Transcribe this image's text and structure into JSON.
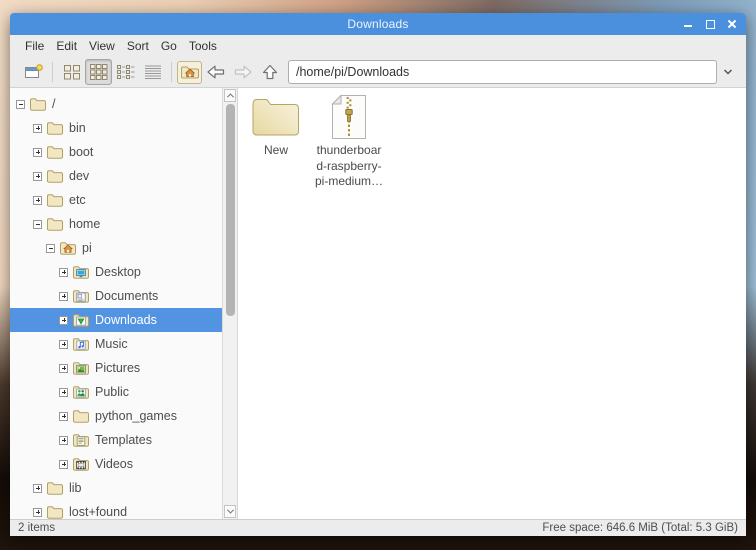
{
  "window": {
    "title": "Downloads",
    "controls": [
      {
        "id": "minimize",
        "icon": "minimize-icon"
      },
      {
        "id": "maximize",
        "icon": "maximize-icon"
      },
      {
        "id": "close",
        "icon": "close-icon"
      }
    ]
  },
  "menubar": {
    "items": [
      "File",
      "Edit",
      "View",
      "Sort",
      "Go",
      "Tools"
    ]
  },
  "toolbar": {
    "path": "/home/pi/Downloads",
    "buttons": [
      {
        "id": "new-window",
        "icon": "new-window-icon"
      },
      {
        "sep": true
      },
      {
        "id": "view-icons",
        "icon": "icon-view-icon"
      },
      {
        "id": "view-thumbnails",
        "icon": "thumbnail-view-icon",
        "active": true
      },
      {
        "id": "view-compact",
        "icon": "compact-view-icon"
      },
      {
        "id": "view-detailed",
        "icon": "detailed-view-icon"
      },
      {
        "sep": true
      },
      {
        "id": "go-home",
        "icon": "home-folder-icon",
        "framed": true
      },
      {
        "id": "go-back",
        "icon": "back-arrow-icon"
      },
      {
        "id": "go-forward",
        "icon": "forward-arrow-icon",
        "disabled": true
      },
      {
        "id": "go-up",
        "icon": "up-arrow-icon"
      },
      {
        "id": "path-dropdown",
        "icon": "chevron-down-icon"
      }
    ]
  },
  "sidebar": {
    "items": [
      {
        "label": "/",
        "level": 0,
        "expander": "minus",
        "icon": "folder"
      },
      {
        "label": "bin",
        "level": 1,
        "expander": "plus",
        "icon": "folder"
      },
      {
        "label": "boot",
        "level": 1,
        "expander": "plus",
        "icon": "folder"
      },
      {
        "label": "dev",
        "level": 1,
        "expander": "plus",
        "icon": "folder"
      },
      {
        "label": "etc",
        "level": 1,
        "expander": "plus",
        "icon": "folder"
      },
      {
        "label": "home",
        "level": 1,
        "expander": "minus",
        "icon": "folder"
      },
      {
        "label": "pi",
        "level": 2,
        "expander": "minus",
        "icon": "folder-home"
      },
      {
        "label": "Desktop",
        "level": 3,
        "expander": "plus",
        "icon": "folder-desktop"
      },
      {
        "label": "Documents",
        "level": 3,
        "expander": "plus",
        "icon": "folder-documents"
      },
      {
        "label": "Downloads",
        "level": 3,
        "expander": "plus",
        "icon": "folder-downloads",
        "selected": true
      },
      {
        "label": "Music",
        "level": 3,
        "expander": "plus",
        "icon": "folder-music"
      },
      {
        "label": "Pictures",
        "level": 3,
        "expander": "plus",
        "icon": "folder-pictures"
      },
      {
        "label": "Public",
        "level": 3,
        "expander": "plus",
        "icon": "folder-public"
      },
      {
        "label": "python_games",
        "level": 3,
        "expander": "plus",
        "icon": "folder"
      },
      {
        "label": "Templates",
        "level": 3,
        "expander": "plus",
        "icon": "folder-templates"
      },
      {
        "label": "Videos",
        "level": 3,
        "expander": "plus",
        "icon": "folder-videos"
      },
      {
        "label": "lib",
        "level": 1,
        "expander": "plus",
        "icon": "folder"
      },
      {
        "label": "lost+found",
        "level": 1,
        "expander": "plus",
        "icon": "folder"
      }
    ]
  },
  "main": {
    "items": [
      {
        "icon": "folder-large",
        "lines": [
          "New"
        ]
      },
      {
        "icon": "zip-file",
        "lines": [
          "thunderboar",
          "d-raspberry-",
          "pi-medium…"
        ]
      }
    ]
  },
  "statusbar": {
    "left": "2 items",
    "right": "Free space: 646.6 MiB (Total: 5.3 GiB)"
  },
  "colors": {
    "titlebar": "#4a90dd",
    "selection": "#5294e2",
    "folder_fill": "#f2e7c2",
    "folder_stroke": "#b0a069"
  }
}
